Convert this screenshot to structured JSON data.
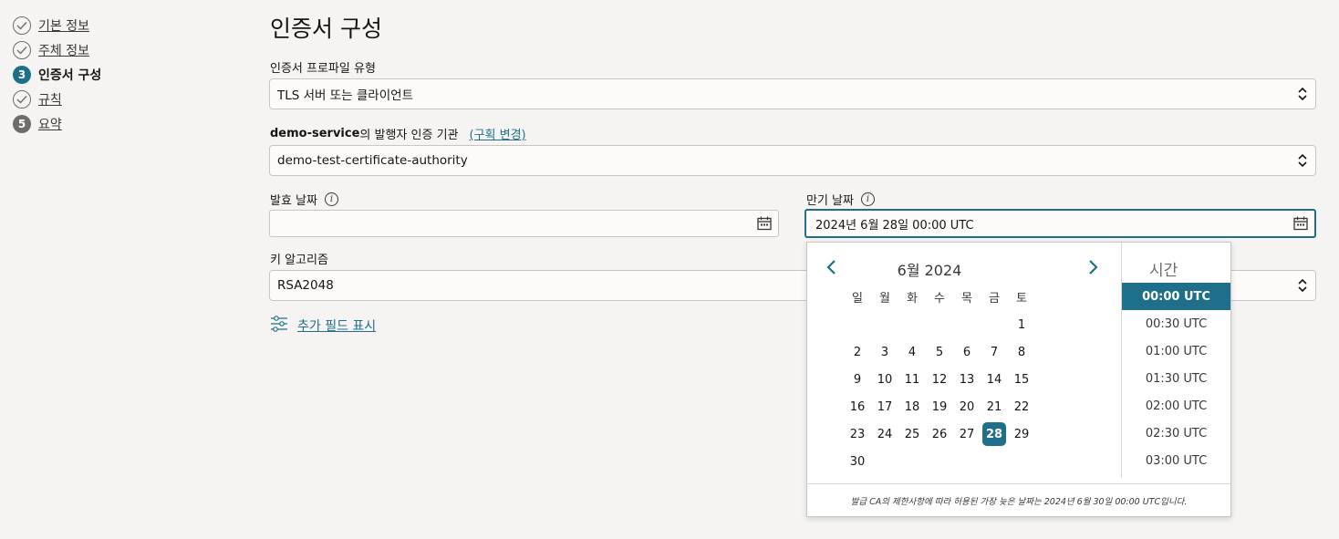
{
  "steps": [
    {
      "num": "1",
      "label": "기본 정보",
      "state": "done"
    },
    {
      "num": "2",
      "label": "주체 정보",
      "state": "done"
    },
    {
      "num": "3",
      "label": "인증서 구성",
      "state": "current"
    },
    {
      "num": "4",
      "label": "규칙",
      "state": "done"
    },
    {
      "num": "5",
      "label": "요약",
      "state": "pending"
    }
  ],
  "page_title": "인증서 구성",
  "profile": {
    "label": "인증서 프로파일 유형",
    "value": "TLS 서버 또는 클라이언트"
  },
  "issuer": {
    "service_name": "demo-service",
    "label_suffix": "의 발행자 인증 기관",
    "change_link": "(구획 변경)",
    "value": "demo-test-certificate-authority"
  },
  "issue_date": {
    "label": "발효 날짜",
    "value": ""
  },
  "expiry_date": {
    "label": "만기 날짜",
    "value": "2024년 6월 28일 00:00 UTC"
  },
  "key_algorithm": {
    "label": "키 알고리즘",
    "value": "RSA2048"
  },
  "more_fields_link": "추가 필드 표시",
  "calendar": {
    "month_title": "6월 2024",
    "weekdays": [
      "일",
      "월",
      "화",
      "수",
      "목",
      "금",
      "토"
    ],
    "weeks": [
      [
        "",
        "",
        "",
        "",
        "",
        "",
        "1"
      ],
      [
        "2",
        "3",
        "4",
        "5",
        "6",
        "7",
        "8"
      ],
      [
        "9",
        "10",
        "11",
        "12",
        "13",
        "14",
        "15"
      ],
      [
        "16",
        "17",
        "18",
        "19",
        "20",
        "21",
        "22"
      ],
      [
        "23",
        "24",
        "25",
        "26",
        "27",
        "28",
        "29"
      ],
      [
        "30",
        "",
        "",
        "",
        "",
        "",
        ""
      ]
    ],
    "selected_day": "28",
    "time_title": "시간",
    "times": [
      "00:00 UTC",
      "00:30 UTC",
      "01:00 UTC",
      "01:30 UTC",
      "02:00 UTC",
      "02:30 UTC",
      "03:00 UTC"
    ],
    "selected_time": "00:00 UTC",
    "note": "발급 CA의 제한사항에 따라 허용된 가장 늦은 날짜는 2024년 6월 30일 00:00 UTC입니다."
  },
  "colors": {
    "accent": "#1f6f8b",
    "pending_step": "#6f6c69"
  },
  "icons": [
    "check-circle-icon",
    "calendar-icon",
    "chevron-left-icon",
    "chevron-right-icon",
    "select-updown-icon",
    "info-icon",
    "filter-sliders-icon"
  ]
}
